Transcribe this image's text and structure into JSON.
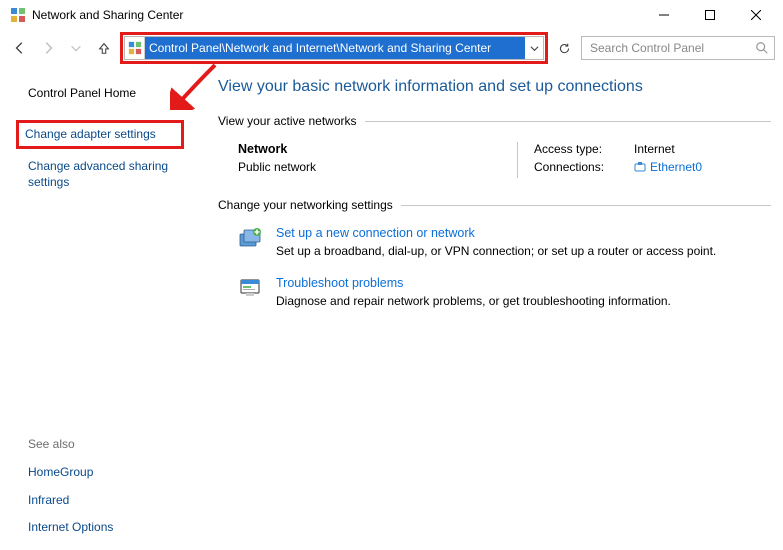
{
  "window": {
    "title": "Network and Sharing Center"
  },
  "address": {
    "path": "Control Panel\\Network and Internet\\Network and Sharing Center"
  },
  "search": {
    "placeholder": "Search Control Panel"
  },
  "sidebar": {
    "home": "Control Panel Home",
    "adapter": "Change adapter settings",
    "advanced": "Change advanced sharing settings",
    "see_also_hdr": "See also",
    "see_also": [
      "HomeGroup",
      "Infrared",
      "Internet Options"
    ]
  },
  "main": {
    "heading": "View your basic network information and set up connections",
    "active_hdr": "View your active networks",
    "network": {
      "name": "Network",
      "type": "Public network",
      "access_label": "Access type:",
      "access_value": "Internet",
      "conn_label": "Connections:",
      "conn_value": "Ethernet0"
    },
    "settings_hdr": "Change your networking settings",
    "actions": [
      {
        "title": "Set up a new connection or network",
        "desc": "Set up a broadband, dial-up, or VPN connection; or set up a router or access point."
      },
      {
        "title": "Troubleshoot problems",
        "desc": "Diagnose and repair network problems, or get troubleshooting information."
      }
    ]
  }
}
